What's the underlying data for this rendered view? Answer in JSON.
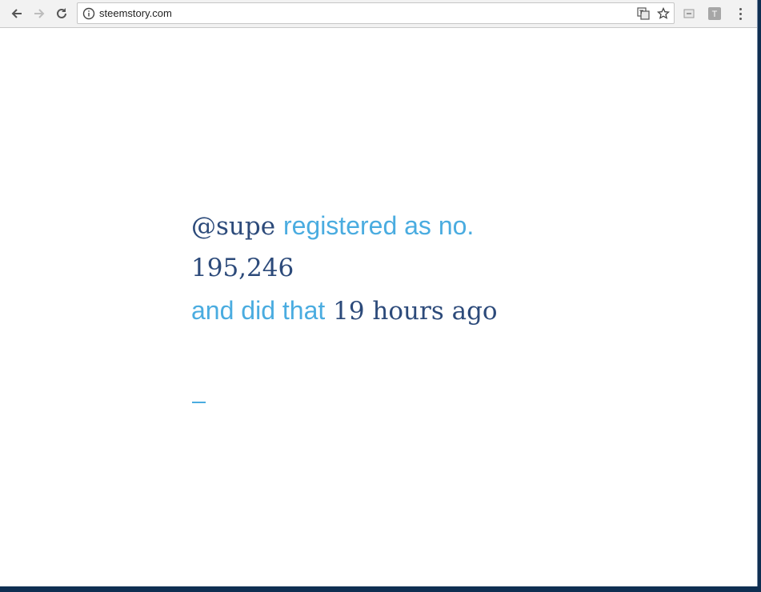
{
  "browser": {
    "url": "steemstory.com",
    "icons": {
      "back": "back-arrow-icon",
      "forward": "forward-arrow-icon",
      "reload": "reload-icon",
      "info": "info-icon",
      "translate": "translate-icon",
      "bookmark": "star-icon",
      "cast": "cast-icon",
      "extension": "extension-icon",
      "menu": "more-vert-icon"
    },
    "extension_label": "T"
  },
  "page": {
    "username": "@supe",
    "registered_text": "registered as no.",
    "number": "195,246",
    "did_text": "and did that",
    "time_ago": "19 hours ago",
    "colors": {
      "dark": "#2c4a7a",
      "light": "#4aace0"
    }
  }
}
